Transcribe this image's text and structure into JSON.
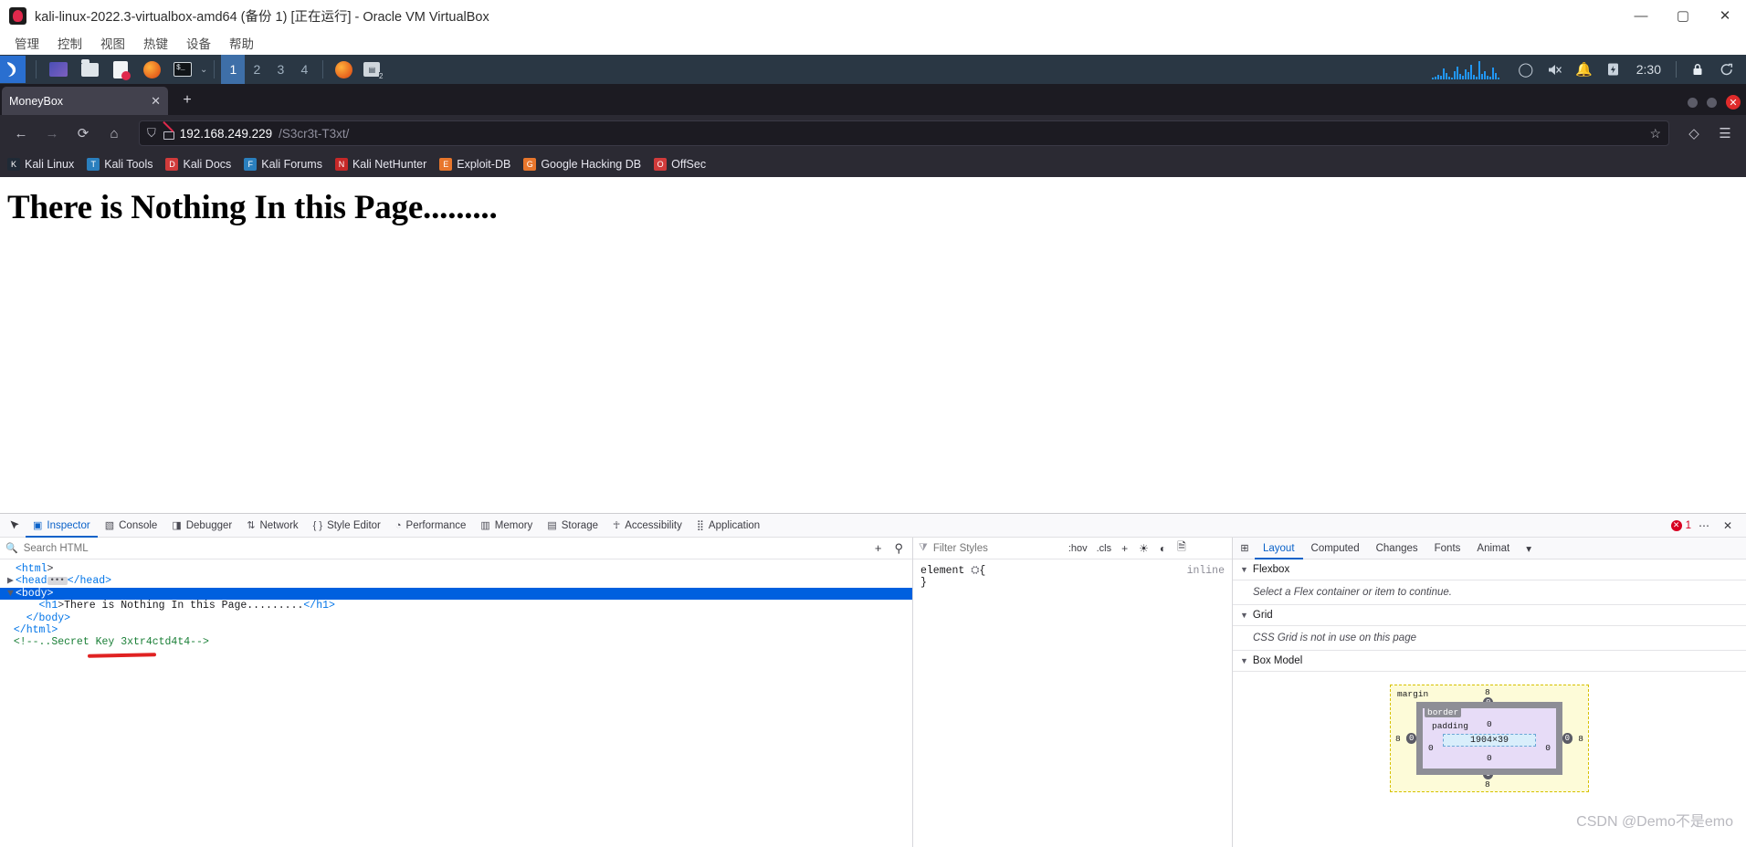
{
  "vbox": {
    "title": "kali-linux-2022.3-virtualbox-amd64 (备份 1) [正在运行] - Oracle VM VirtualBox",
    "window_buttons": {
      "minimize": "—",
      "maximize": "▢",
      "close": "✕"
    },
    "menu": [
      "管理",
      "控制",
      "视图",
      "热键",
      "设备",
      "帮助"
    ]
  },
  "taskbar": {
    "kali_logo": "kali-dragon-icon",
    "launchers": [
      "purple-app-icon",
      "file-manager-icon",
      "text-editor-icon",
      "firefox-icon",
      "terminal-icon"
    ],
    "dropdown_chevron": "⌄",
    "workspaces": [
      "1",
      "2",
      "3",
      "4"
    ],
    "active_workspace": "1",
    "task_items": [
      {
        "icon": "firefox-icon",
        "label": ""
      },
      {
        "icon": "window-badge-icon",
        "label": "2"
      }
    ],
    "tray": {
      "cpu_graph": "cpu-graph",
      "cpu_bars": [
        2,
        3,
        5,
        4,
        12,
        7,
        3,
        2,
        9,
        14,
        6,
        4,
        11,
        8,
        16,
        5,
        3,
        20,
        6,
        9,
        4,
        3,
        13,
        7,
        2
      ],
      "icons": [
        "refresh-circle-icon",
        "speaker-muted-icon",
        "notification-bell-icon",
        "battery-charging-icon"
      ],
      "clock": "2:30",
      "lock_icon": "lock-icon",
      "power_icon": "power-icon"
    }
  },
  "browser": {
    "tab": {
      "title": "MoneyBox",
      "close": "✕"
    },
    "new_tab": "+",
    "nav": {
      "back": "←",
      "forward": "→",
      "reload": "⟳",
      "home": "⌂"
    },
    "url": {
      "host": "192.168.249.229",
      "path": "/S3cr3t-T3xt/",
      "shield_icon": "shield-icon",
      "insecure_icon": "broken-lock-icon",
      "bookmark_star": "☆"
    },
    "toolbar_right": {
      "pocket": "◇",
      "menu": "☰"
    },
    "bookmarks": [
      {
        "label": "Kali Linux",
        "icon": "kali-dragon-icon",
        "color": "#1f2a36"
      },
      {
        "label": "Kali Tools",
        "icon": "kali-tools-icon",
        "color": "#2a7fbe"
      },
      {
        "label": "Kali Docs",
        "icon": "kali-docs-icon",
        "color": "#d13b3b"
      },
      {
        "label": "Kali Forums",
        "icon": "kali-forums-icon",
        "color": "#2a7fbe"
      },
      {
        "label": "Kali NetHunter",
        "icon": "kali-nethunter-icon",
        "color": "#c62828"
      },
      {
        "label": "Exploit-DB",
        "icon": "exploit-db-icon",
        "color": "#e8762c"
      },
      {
        "label": "Google Hacking DB",
        "icon": "google-hacking-db-icon",
        "color": "#e8762c"
      },
      {
        "label": "OffSec",
        "icon": "offsec-icon",
        "color": "#d13b3b"
      }
    ]
  },
  "page": {
    "heading": "There is Nothing In this Page........."
  },
  "devtools": {
    "tabs": [
      {
        "label": "Inspector",
        "icon": "inspector-icon",
        "active": true
      },
      {
        "label": "Console",
        "icon": "console-icon",
        "active": false
      },
      {
        "label": "Debugger",
        "icon": "debugger-icon",
        "active": false
      },
      {
        "label": "Network",
        "icon": "network-icon",
        "active": false
      },
      {
        "label": "Style Editor",
        "icon": "style-editor-icon",
        "active": false
      },
      {
        "label": "Performance",
        "icon": "performance-icon",
        "active": false
      },
      {
        "label": "Memory",
        "icon": "memory-icon",
        "active": false
      },
      {
        "label": "Storage",
        "icon": "storage-icon",
        "active": false
      },
      {
        "label": "Accessibility",
        "icon": "accessibility-icon",
        "active": false
      },
      {
        "label": "Application",
        "icon": "application-icon",
        "active": false
      }
    ],
    "picker_icon": "element-picker-icon",
    "error_count": "1",
    "meatball_icon": "⋯",
    "close_icon": "✕",
    "search": {
      "placeholder": "Search HTML",
      "value": "",
      "icon": "search-icon",
      "add_node": "+",
      "eyedropper": "eyedropper-icon"
    },
    "markup": [
      {
        "indent": 0,
        "twisty": "",
        "html_parts": [
          {
            "t": "tag",
            "v": "<html"
          },
          {
            "t": "pnt",
            "v": ">"
          }
        ],
        "selected": false
      },
      {
        "indent": 0,
        "twisty": "▶",
        "html_parts": [
          {
            "t": "tag",
            "v": "<head"
          },
          {
            "t": "ellipsis",
            "v": "…"
          },
          {
            "t": "tag",
            "v": "</head>"
          }
        ],
        "selected": false
      },
      {
        "indent": 0,
        "twisty": "▼",
        "html_parts": [
          {
            "t": "tag",
            "v": "<body"
          },
          {
            "t": "pnt",
            "v": ">"
          }
        ],
        "selected": true
      },
      {
        "indent": 2,
        "twisty": "",
        "html_parts": [
          {
            "t": "tag",
            "v": "<h1"
          },
          {
            "t": "pnt",
            "v": ">"
          },
          {
            "t": "txt",
            "v": "There is Nothing In this Page........."
          },
          {
            "t": "tag",
            "v": "</h1>"
          }
        ],
        "selected": false
      },
      {
        "indent": 1,
        "twisty": "",
        "html_parts": [
          {
            "t": "tag",
            "v": "</body>"
          }
        ],
        "selected": false
      },
      {
        "indent": 0,
        "twisty": "",
        "html_parts": [
          {
            "t": "tag",
            "v": "</html>"
          }
        ],
        "selected": false
      },
      {
        "indent": 0,
        "twisty": "",
        "html_parts": [
          {
            "t": "cmt",
            "v": "<!--..Secret Key 3xtr4ctd4t4-->"
          }
        ],
        "selected": false
      }
    ],
    "highlight_note": "red-underline-on-secret-key",
    "rules": {
      "filter_placeholder": "Filter Styles",
      "hov": ":hov",
      "cls": ".cls",
      "add_rule": "+",
      "light_scheme_icon": "light-scheme-icon",
      "dark_scheme_icon": "dark-scheme-icon",
      "print_media_icon": "print-media-icon",
      "selector": "element",
      "config_icon": "config-icon",
      "brace_open": "{",
      "brace_close": "}",
      "origin": "inline"
    },
    "layout": {
      "panel_toggle_icon": "panel-toggle-icon",
      "tabs": [
        {
          "label": "Layout",
          "active": true
        },
        {
          "label": "Computed",
          "active": false
        },
        {
          "label": "Changes",
          "active": false
        },
        {
          "label": "Fonts",
          "active": false
        },
        {
          "label": "Animat",
          "active": false
        }
      ],
      "overflow_icon": "▾",
      "flexbox": {
        "title": "Flexbox",
        "note": "Select a Flex container or item to continue."
      },
      "grid": {
        "title": "Grid",
        "note": "CSS Grid is not in use on this page"
      },
      "box_model": {
        "title": "Box Model",
        "margin_label": "margin",
        "border_label": "border",
        "padding_label": "padding",
        "content_size": "1904×39",
        "margin": {
          "top": "8",
          "right": "8",
          "bottom": "8",
          "left": "8"
        },
        "border": {
          "top": "0",
          "right": "0",
          "bottom": "0",
          "left": "0"
        },
        "padding": {
          "top": "0",
          "right": "0",
          "bottom": "0",
          "left": "0"
        }
      }
    }
  },
  "watermark": "CSDN @Demo不是emo"
}
